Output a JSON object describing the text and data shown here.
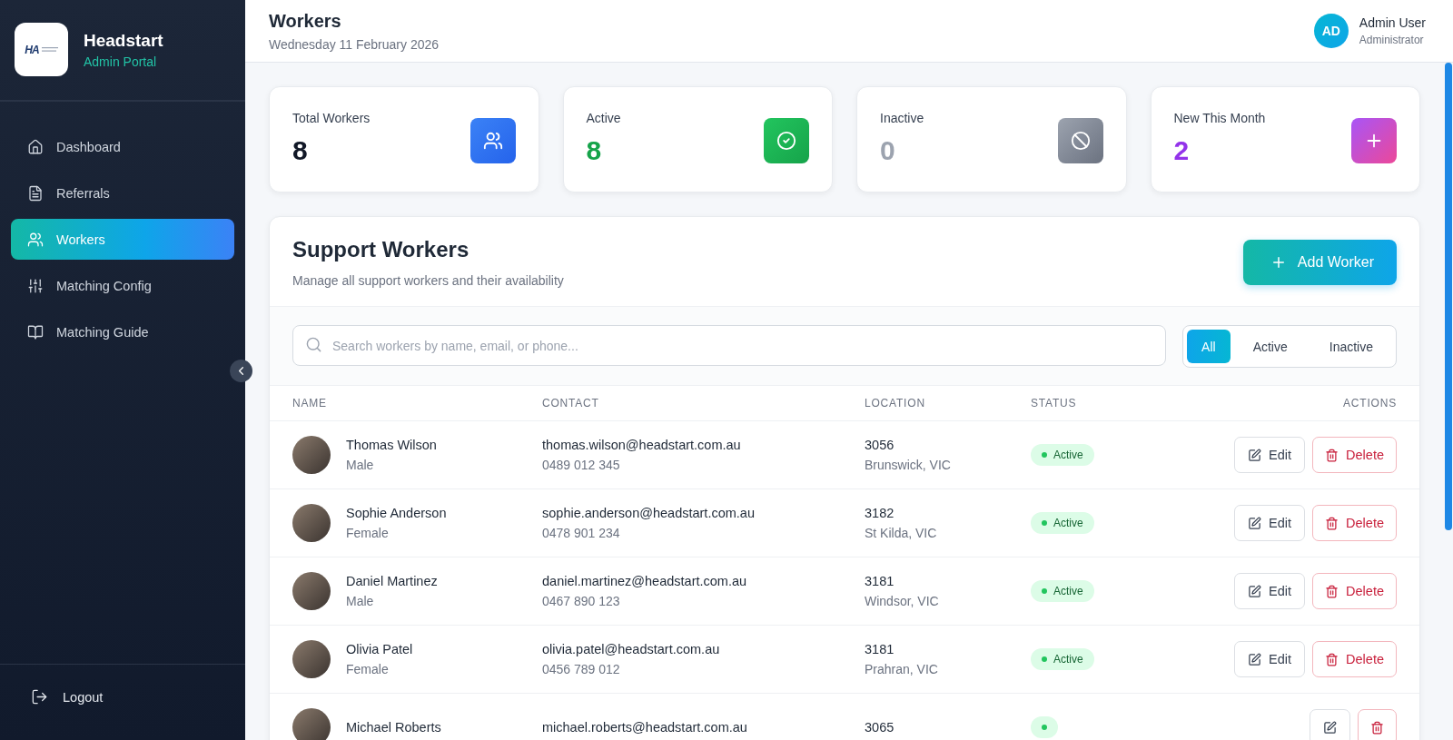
{
  "sidebar": {
    "logo_mark": "HA",
    "brand": "Headstart",
    "subtitle": "Admin Portal",
    "items": [
      {
        "label": "Dashboard",
        "kind": "home",
        "selected": false
      },
      {
        "label": "Referrals",
        "kind": "file",
        "selected": false
      },
      {
        "label": "Workers",
        "kind": "users",
        "selected": true
      },
      {
        "label": "Matching Config",
        "kind": "sliders",
        "selected": false
      },
      {
        "label": "Matching Guide",
        "kind": "book",
        "selected": false
      }
    ],
    "logout": "Logout"
  },
  "header": {
    "title": "Workers",
    "date": "Wednesday 11 February 2026",
    "user_initials": "AD",
    "user_name": "Admin User",
    "user_role": "Administrator"
  },
  "stats": [
    {
      "label": "Total Workers",
      "value": "8",
      "kind": "total"
    },
    {
      "label": "Active",
      "value": "8",
      "kind": "active"
    },
    {
      "label": "Inactive",
      "value": "0",
      "kind": "inactive"
    },
    {
      "label": "New This Month",
      "value": "2",
      "kind": "new"
    }
  ],
  "panel": {
    "title": "Support Workers",
    "subtitle": "Manage all support workers and their availability",
    "add_button": "Add Worker",
    "search": {
      "placeholder": "Search workers by name, email, or phone..."
    },
    "filters": [
      {
        "label": "All",
        "selected": true
      },
      {
        "label": "Active",
        "selected": false
      },
      {
        "label": "Inactive",
        "selected": false
      }
    ],
    "table": {
      "columns": [
        "NAME",
        "CONTACT",
        "LOCATION",
        "STATUS",
        "ACTIONS"
      ],
      "rows": [
        {
          "name": "Thomas Wilson",
          "gender": "Male",
          "email": "thomas.wilson@headstart.com.au",
          "phone": "0489 012 345",
          "postcode": "3056",
          "suburb": "Brunswick, VIC",
          "status": "Active",
          "active": true,
          "edit": "Edit",
          "delete": "Delete"
        },
        {
          "name": "Sophie Anderson",
          "gender": "Female",
          "email": "sophie.anderson@headstart.com.au",
          "phone": "0478 901 234",
          "postcode": "3182",
          "suburb": "St Kilda, VIC",
          "status": "Active",
          "active": true,
          "edit": "Edit",
          "delete": "Delete"
        },
        {
          "name": "Daniel Martinez",
          "gender": "Male",
          "email": "daniel.martinez@headstart.com.au",
          "phone": "0467 890 123",
          "postcode": "3181",
          "suburb": "Windsor, VIC",
          "status": "Active",
          "active": true,
          "edit": "Edit",
          "delete": "Delete"
        },
        {
          "name": "Olivia Patel",
          "gender": "Female",
          "email": "olivia.patel@headstart.com.au",
          "phone": "0456 789 012",
          "postcode": "3181",
          "suburb": "Prahran, VIC",
          "status": "Active",
          "active": true,
          "edit": "Edit",
          "delete": "Delete"
        },
        {
          "name": "Michael Roberts",
          "email": "michael.roberts@headstart.com.au",
          "postcode": "3065",
          "active": true
        }
      ]
    }
  }
}
